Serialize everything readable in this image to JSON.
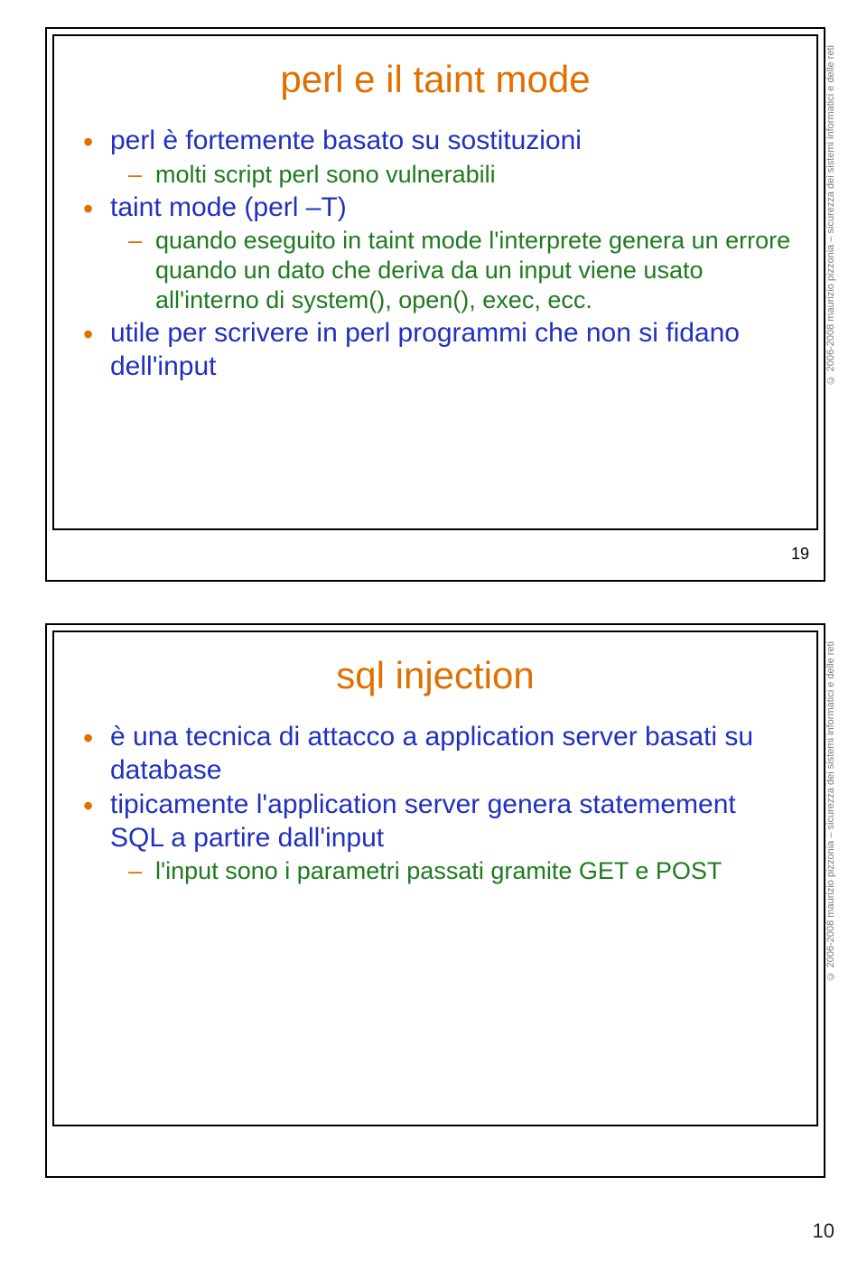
{
  "slides": [
    {
      "title": "perl e il taint mode",
      "bullets": [
        {
          "level": 1,
          "text": "perl è fortemente basato su sostituzioni"
        },
        {
          "level": 2,
          "text": "molti script perl sono vulnerabili"
        },
        {
          "level": 1,
          "text": "taint mode (perl –T)"
        },
        {
          "level": 2,
          "text": "quando eseguito in taint mode l'interprete genera un errore quando un dato che deriva da un input viene usato all'interno di system(), open(), exec, ecc."
        },
        {
          "level": 1,
          "text": "utile per scrivere in perl programmi che non si fidano dell'input"
        }
      ],
      "side": "© 2006-2008 maurizio pizzonia – sicurezza dei sistemi informatici e delle reti",
      "num": "19"
    },
    {
      "title": "sql injection",
      "bullets": [
        {
          "level": 1,
          "text": "è una tecnica di attacco a application server basati su database"
        },
        {
          "level": 1,
          "text": "tipicamente l'application server genera statemement SQL a partire dall'input"
        },
        {
          "level": 2,
          "text": "l'input sono i parametri passati gramite GET e POST"
        }
      ],
      "side": "© 2006-2008 maurizio pizzonia – sicurezza dei sistemi informatici e delle reti",
      "num": ""
    }
  ],
  "footer_page": "10"
}
